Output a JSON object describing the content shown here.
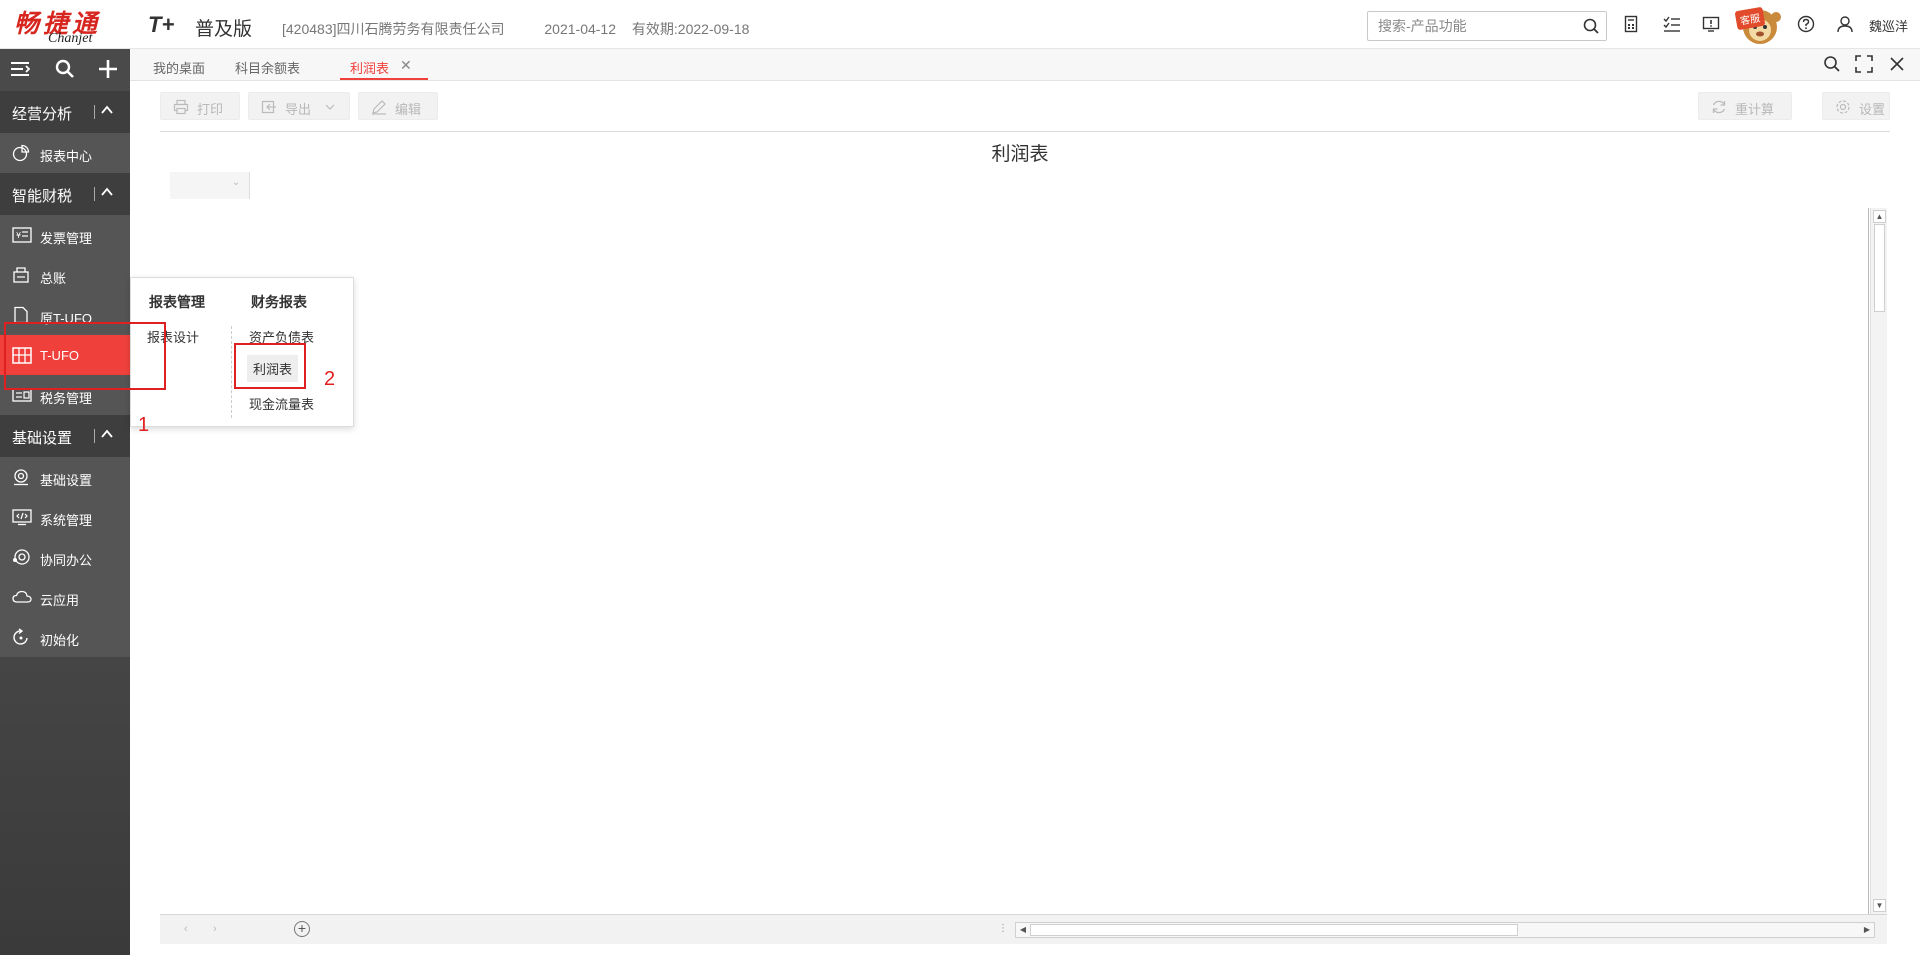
{
  "header": {
    "brand_cn": "畅捷通",
    "brand_en": "Chanjet",
    "product": "T+",
    "edition": "普及版",
    "company": "[420483]四川石腾劳务有限责任公司",
    "date": "2021-04-12",
    "valid": "有效期:2022-09-18",
    "search_placeholder": "搜索-产品功能",
    "mascot_badge": "客服",
    "username": "魏巡洋"
  },
  "sidebar": {
    "groups": [
      {
        "label": "经营分析"
      },
      {
        "label": "智能财税"
      },
      {
        "label": "基础设置"
      }
    ],
    "items": {
      "report_center": "报表中心",
      "invoice": "发票管理",
      "ledger": "总账",
      "old_tufo": "原T-UFO",
      "tufo": "T-UFO",
      "tax": "税务管理",
      "basic": "基础设置",
      "system": "系统管理",
      "collab": "协同办公",
      "cloud": "云应用",
      "init": "初始化"
    }
  },
  "tabs": [
    {
      "label": "我的桌面"
    },
    {
      "label": "科目余额表"
    },
    {
      "label": "利润表"
    }
  ],
  "toolbar": {
    "print": "打印",
    "export": "导出",
    "edit": "编辑",
    "recalc": "重计算",
    "settings": "设置"
  },
  "report": {
    "title": "利润表"
  },
  "popup": {
    "col1_title": "报表管理",
    "col1_items": [
      "报表设计"
    ],
    "col2_title": "财务报表",
    "col2_items": [
      "资产负债表",
      "利润表",
      "现金流量表"
    ]
  },
  "annotations": [
    "1",
    "2"
  ],
  "colors": {
    "accent": "#f0403c",
    "annotation": "#e02020"
  }
}
